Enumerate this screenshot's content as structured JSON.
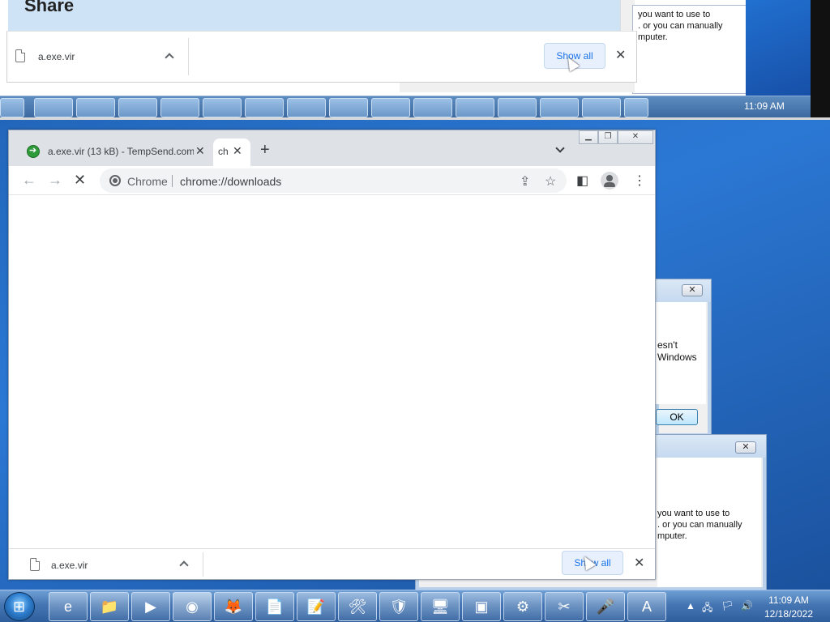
{
  "top_screenshot": {
    "heading": "Share",
    "dialog_text": [
      "you want to use to",
      ". or you can manually",
      "mputer."
    ],
    "download": {
      "filename": "a.exe.vir",
      "show_all": "Show all",
      "close": "✕"
    },
    "clock": "11:09 AM"
  },
  "dialogs": {
    "dialog1": {
      "close": "✕",
      "lines": [
        "esn't",
        "Windows"
      ],
      "ok": "OK"
    },
    "dialog2": {
      "close": "✕",
      "lines": [
        "you want to use to",
        ". or you can manually",
        "mputer."
      ]
    }
  },
  "chrome": {
    "tabs": [
      {
        "title": "a.exe.vir (13 kB) - TempSend.com",
        "close": "✕"
      },
      {
        "title": "ch",
        "close": "✕"
      }
    ],
    "new_tab": "+",
    "window_buttons": {
      "minimize": "▁",
      "restore": "❐",
      "close": "✕"
    },
    "toolbar": {
      "back": "←",
      "forward": "→",
      "stop": "✕",
      "omni_chip": "Chrome",
      "url": "chrome://downloads",
      "share": "⇪",
      "star": "☆",
      "side_panel": "◧",
      "menu": "⋮"
    },
    "download_bar": {
      "filename": "a.exe.vir",
      "show_all": "Show all",
      "close": "✕"
    }
  },
  "taskbar": {
    "start": "⊞",
    "items": [
      {
        "name": "ie",
        "glyph": "e"
      },
      {
        "name": "explorer",
        "glyph": "📁"
      },
      {
        "name": "media",
        "glyph": "▶"
      },
      {
        "name": "chrome",
        "glyph": "◉"
      },
      {
        "name": "firefox",
        "glyph": "🦊"
      },
      {
        "name": "document",
        "glyph": "📄"
      },
      {
        "name": "notepad",
        "glyph": "📝"
      },
      {
        "name": "tools",
        "glyph": "🛠"
      },
      {
        "name": "security",
        "glyph": "🛡"
      },
      {
        "name": "monitor",
        "glyph": "🖥"
      },
      {
        "name": "terminal",
        "glyph": "▣"
      },
      {
        "name": "control-panel",
        "glyph": "⚙"
      },
      {
        "name": "snipping",
        "glyph": "✂"
      },
      {
        "name": "microphone",
        "glyph": "🎤"
      },
      {
        "name": "wordpad",
        "glyph": "A"
      }
    ],
    "time": "11:09 AM",
    "date": "12/18/2022",
    "tray_arrow": "▲",
    "tray_icons": [
      "🖧",
      "🏳",
      "🔊"
    ]
  },
  "colors": {
    "chrome_accent": "#1a73e8",
    "taskbar": "#4576b3"
  }
}
